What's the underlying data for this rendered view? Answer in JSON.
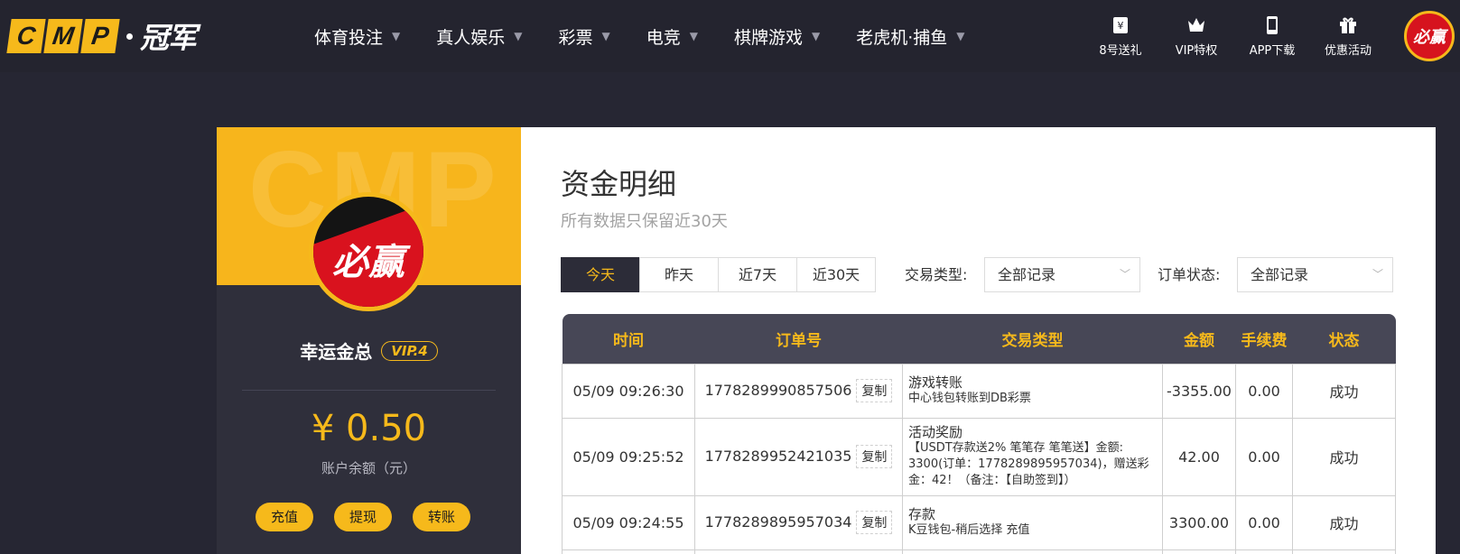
{
  "header": {
    "logo_letters": [
      "C",
      "M",
      "P"
    ],
    "logo_text": "冠军",
    "nav": [
      {
        "label": "体育投注"
      },
      {
        "label": "真人娱乐"
      },
      {
        "label": "彩票"
      },
      {
        "label": "电竞"
      },
      {
        "label": "棋牌游戏"
      },
      {
        "label": "老虎机·捕鱼"
      }
    ],
    "quick_links": [
      {
        "label": "8号送礼",
        "icon": "gift-box-icon"
      },
      {
        "label": "VIP特权",
        "icon": "crown-icon"
      },
      {
        "label": "APP下载",
        "icon": "phone-icon"
      },
      {
        "label": "优惠活动",
        "icon": "present-icon"
      }
    ],
    "avatar_text": "必赢"
  },
  "profile": {
    "watermark": "CMP",
    "avatar_text": "必赢",
    "username": "幸运金总",
    "vip": "VIP.4",
    "balance": "¥ 0.50",
    "balance_label": "账户余额（元）",
    "actions": [
      "充值",
      "提现",
      "转账"
    ]
  },
  "main": {
    "title": "资金明细",
    "subtitle": "所有数据只保留近30天",
    "tabs": [
      "今天",
      "昨天",
      "近7天",
      "近30天"
    ],
    "active_tab": "今天",
    "filters": {
      "type_label": "交易类型:",
      "type_value": "全部记录",
      "status_label": "订单状态:",
      "status_value": "全部记录"
    },
    "table": {
      "headers": [
        "时间",
        "订单号",
        "交易类型",
        "金额",
        "手续费",
        "状态"
      ],
      "copy_label": "复制",
      "rows": [
        {
          "time": "05/09 09:26:30",
          "order": "1778289990857506",
          "type_main": "游戏转账",
          "type_sub": "中心钱包转账到DB彩票",
          "amount": "-3355.00",
          "fee": "0.00",
          "status": "成功"
        },
        {
          "time": "05/09 09:25:52",
          "order": "1778289952421035",
          "type_main": "活动奖励",
          "type_sub": "【USDT存款送2% 笔笔存 笔笔送】金额: 3300(订单：1778289895957034)，赠送彩金：42！（备注：【自助签到】）",
          "amount": "42.00",
          "fee": "0.00",
          "status": "成功"
        },
        {
          "time": "05/09 09:24:55",
          "order": "1778289895957034",
          "type_main": "存款",
          "type_sub": "K豆钱包-稍后选择 充值",
          "amount": "3300.00",
          "fee": "0.00",
          "status": "成功"
        }
      ]
    }
  },
  "colors": {
    "accent": "#f6b91b",
    "background": "#262633",
    "success": "#2e9a2e"
  }
}
